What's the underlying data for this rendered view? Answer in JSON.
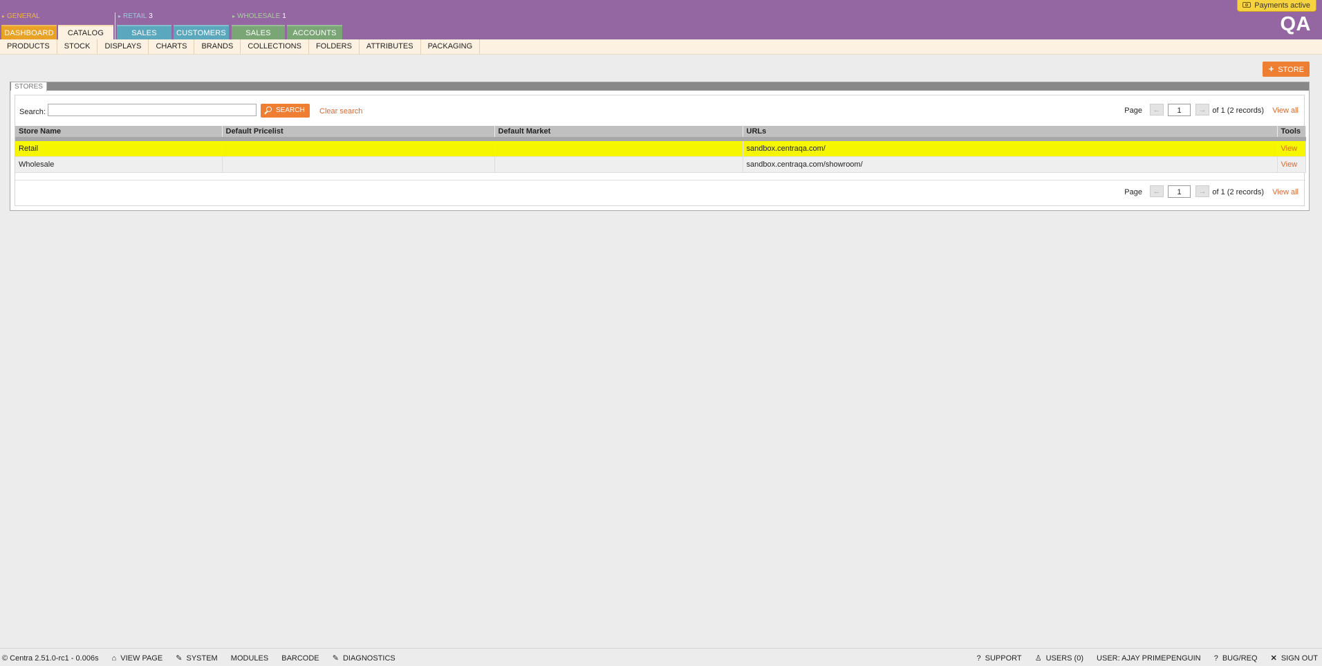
{
  "header": {
    "groups": [
      {
        "label": "GENERAL",
        "count": ""
      },
      {
        "label": "RETAIL",
        "count": "3"
      },
      {
        "label": "WHOLESALE",
        "count": "1"
      }
    ],
    "tabs": [
      "DASHBOARD",
      "CATALOG",
      "SALES",
      "CUSTOMERS",
      "SALES",
      "ACCOUNTS"
    ],
    "payments_badge": "Payments active",
    "env_label": "QA"
  },
  "subnav": [
    "PRODUCTS",
    "STOCK",
    "DISPLAYS",
    "CHARTS",
    "BRANDS",
    "COLLECTIONS",
    "FOLDERS",
    "ATTRIBUTES",
    "PACKAGING"
  ],
  "actions": {
    "add_store": "STORE"
  },
  "panel": {
    "title": "STORES",
    "search": {
      "label": "Search:",
      "value": "",
      "button": "SEARCH",
      "clear": "Clear search"
    },
    "pager": {
      "page_label": "Page",
      "page": "1",
      "info": "of 1 (2 records)",
      "view_all": "View all"
    },
    "table": {
      "columns": [
        "Store Name",
        "Default Pricelist",
        "Default Market",
        "URLs",
        "Tools"
      ],
      "rows": [
        {
          "name": "Retail",
          "pricelist": "",
          "market": "",
          "url": "sandbox.centraqa.com/",
          "tool": "View",
          "highlighted": true
        },
        {
          "name": "Wholesale",
          "pricelist": "",
          "market": "",
          "url": "sandbox.centraqa.com/showroom/",
          "tool": "View",
          "highlighted": false
        }
      ]
    }
  },
  "footer": {
    "version": "© Centra 2.51.0-rc1 - 0.006s",
    "left_links": [
      "VIEW PAGE",
      "SYSTEM",
      "MODULES",
      "BARCODE",
      "DIAGNOSTICS"
    ],
    "right_links": [
      "SUPPORT",
      "USERS (0)",
      "USER: AJAY PRIMEPENGUIN",
      "BUG/REQ",
      "SIGN OUT"
    ]
  },
  "colors": {
    "header_bg": "#9466a2",
    "accent_orange": "#ee7e32",
    "dashboard_tab": "#e8a326",
    "retail_tabs": "#5ba7bd",
    "wholesale_tabs": "#7aa575",
    "row_highlight": "#f6f601"
  }
}
